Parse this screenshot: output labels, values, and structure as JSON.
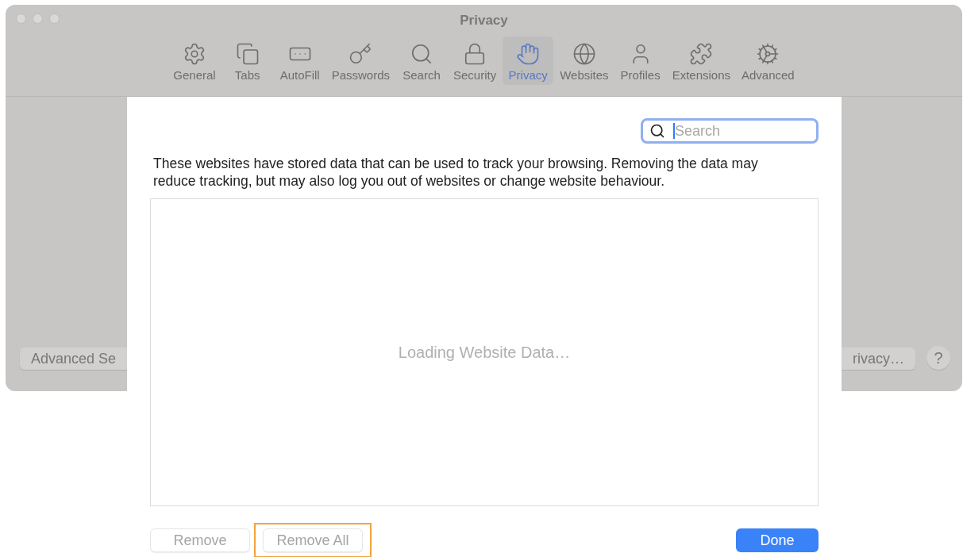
{
  "window": {
    "title": "Privacy"
  },
  "toolbar": [
    {
      "label": "General",
      "selected": false
    },
    {
      "label": "Tabs",
      "selected": false
    },
    {
      "label": "AutoFill",
      "selected": false
    },
    {
      "label": "Passwords",
      "selected": false
    },
    {
      "label": "Search",
      "selected": false
    },
    {
      "label": "Security",
      "selected": false
    },
    {
      "label": "Privacy",
      "selected": true
    },
    {
      "label": "Websites",
      "selected": false
    },
    {
      "label": "Profiles",
      "selected": false
    },
    {
      "label": "Extensions",
      "selected": false
    },
    {
      "label": "Advanced",
      "selected": false
    }
  ],
  "window_buttons": {
    "left": "Advanced Se",
    "right": "rivacy…",
    "help": "?"
  },
  "sheet": {
    "search": {
      "placeholder": "Search",
      "focused": true
    },
    "description": "These websites have stored data that can be used to track your browsing. Removing the data may reduce tracking, but may also log you out of websites or change website behaviour.",
    "list_status": "Loading Website Data…",
    "buttons": [
      {
        "label": "Remove",
        "kind": "default",
        "disabled": true,
        "highlighted": false
      },
      {
        "label": "Remove All",
        "kind": "default",
        "disabled": true,
        "highlighted": true
      },
      {
        "label": "Done",
        "kind": "primary",
        "disabled": false,
        "highlighted": false
      }
    ]
  }
}
